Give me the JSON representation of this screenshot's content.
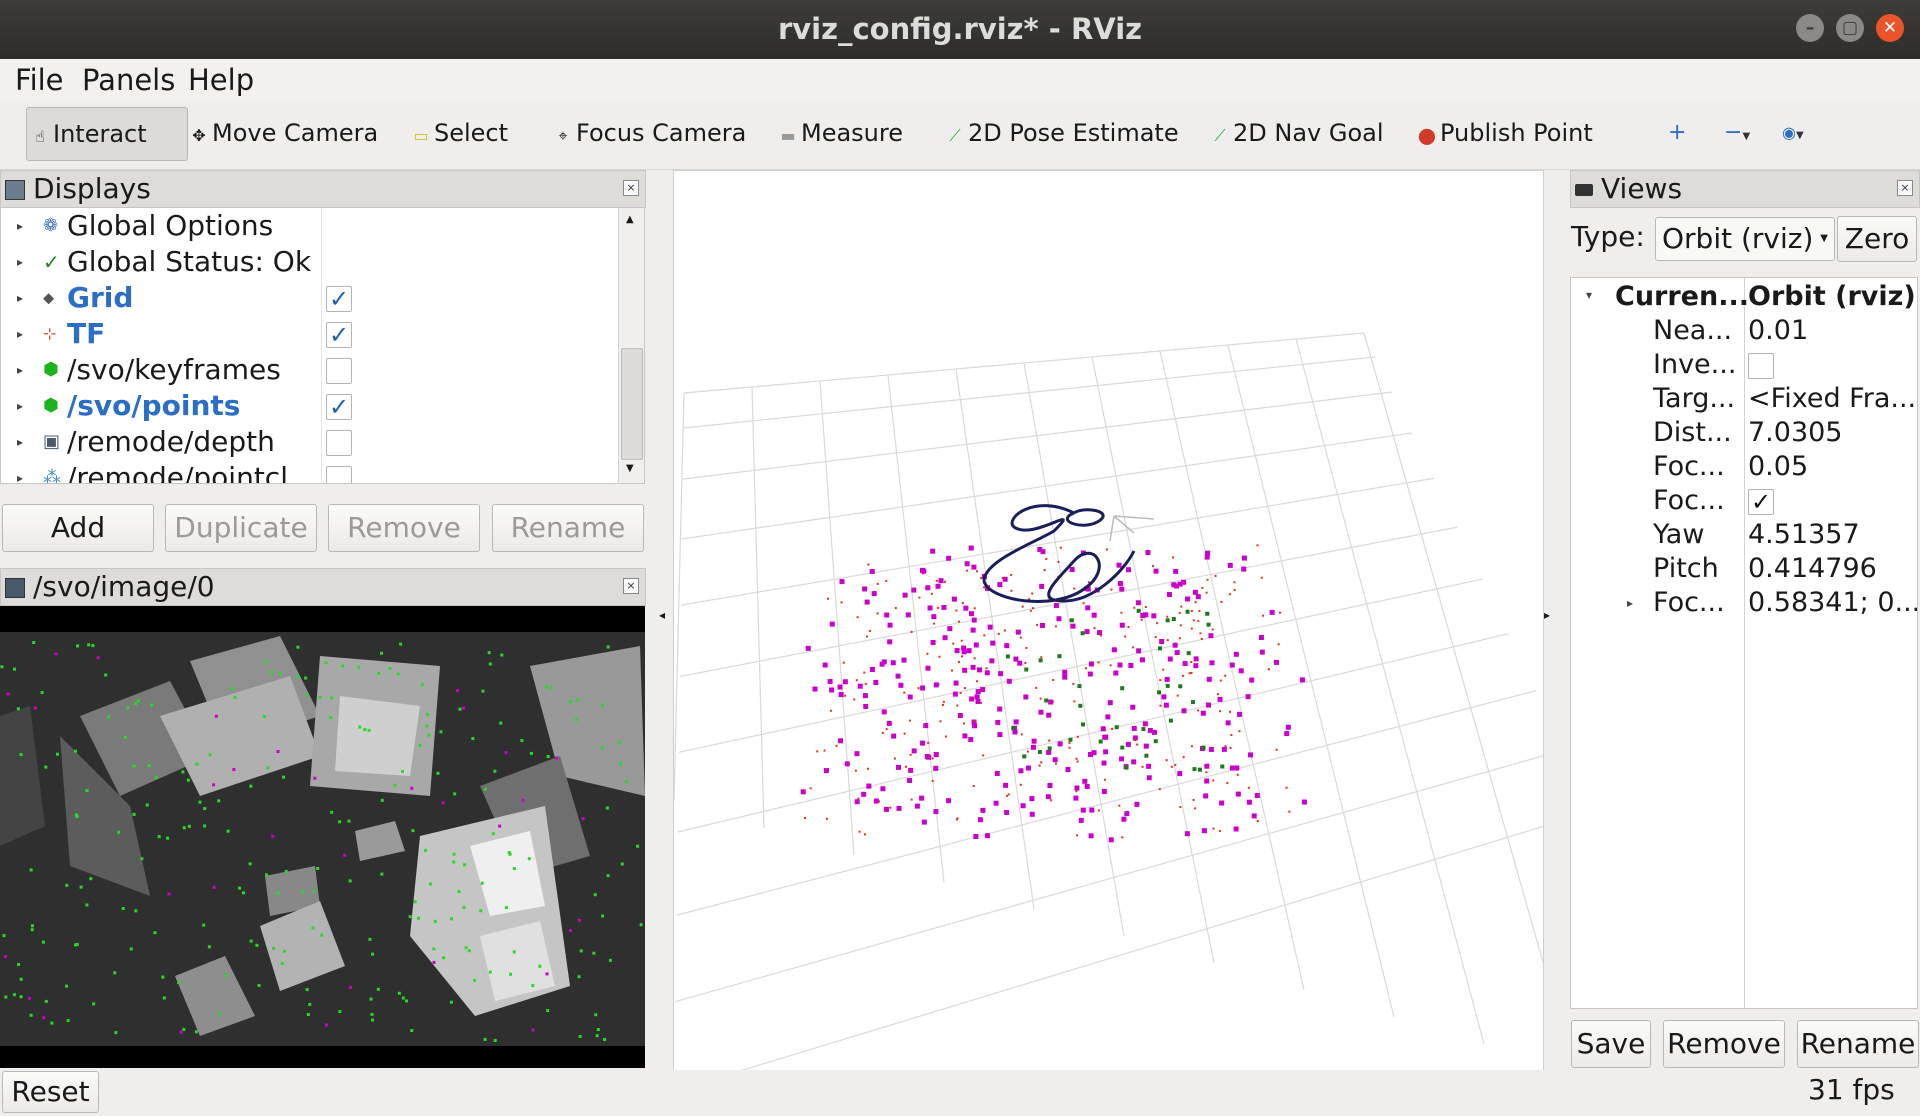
{
  "window": {
    "title": "rviz_config.rviz* - RViz"
  },
  "menubar": {
    "items": [
      "File",
      "Panels",
      "Help"
    ]
  },
  "toolbar": {
    "tools": [
      "Interact",
      "Move Camera",
      "Select",
      "Focus Camera",
      "Measure",
      "2D Pose Estimate",
      "2D Nav Goal",
      "Publish Point"
    ],
    "active": "Interact"
  },
  "displays": {
    "title": "Displays",
    "items": [
      {
        "label": "Global Options",
        "checked": null,
        "highlight": false
      },
      {
        "label": "Global Status: Ok",
        "checked": null,
        "highlight": false
      },
      {
        "label": "Grid",
        "checked": true,
        "highlight": true
      },
      {
        "label": "TF",
        "checked": true,
        "highlight": true
      },
      {
        "label": "/svo/keyframes",
        "checked": false,
        "highlight": false
      },
      {
        "label": "/svo/points",
        "checked": true,
        "highlight": true
      },
      {
        "label": "/remode/depth",
        "checked": false,
        "highlight": false
      },
      {
        "label": "/remode/pointcl",
        "checked": false,
        "highlight": false
      }
    ],
    "buttons": [
      "Add",
      "Duplicate",
      "Remove",
      "Rename"
    ]
  },
  "image_panel": {
    "title": "/svo/image/0"
  },
  "views": {
    "title": "Views",
    "type_label": "Type:",
    "type_value": "Orbit (rviz)",
    "zero_label": "Zero",
    "header_key": "Curren...",
    "header_val": "Orbit (rviz)",
    "properties": [
      {
        "key": "Nea...",
        "value": "0.01"
      },
      {
        "key": "Inve...",
        "value": ""
      },
      {
        "key": "Targ...",
        "value": "<Fixed Fra..."
      },
      {
        "key": "Dist...",
        "value": "7.0305"
      },
      {
        "key": "Foc...",
        "value": "0.05"
      },
      {
        "key": "Foc...",
        "value": "✓"
      },
      {
        "key": "Yaw",
        "value": "4.51357"
      },
      {
        "key": "Pitch",
        "value": "0.414796"
      },
      {
        "key": "Foc...",
        "value": "0.58341; 0..."
      }
    ],
    "buttons": [
      "Save",
      "Remove",
      "Rename"
    ]
  },
  "statusbar": {
    "reset_label": "Reset",
    "fps": "31 fps"
  },
  "colors": {
    "accent": "#2a6ec6",
    "points": "#cc00cc",
    "features": "#22dd22",
    "trajectory": "#1a1f5c"
  }
}
